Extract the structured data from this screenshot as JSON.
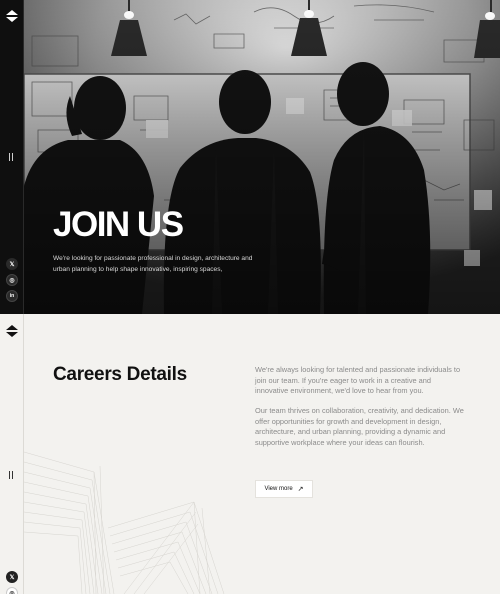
{
  "hero": {
    "title": "JOIN US",
    "description": "We're looking for passionate professional in design, architecture and urban planning to help shape innovative, inspiring spaces,"
  },
  "social": [
    {
      "icon": "x-icon",
      "glyph": "𝕏"
    },
    {
      "icon": "instagram-icon",
      "glyph": "◎"
    },
    {
      "icon": "linkedin-icon",
      "glyph": "in"
    }
  ],
  "careers": {
    "title": "Careers Details",
    "paragraph_1": "We're always looking for talented and passionate individuals to join our team. If you're eager to work in a creative and innovative environment, we'd love to hear from you.",
    "paragraph_2": "Our team thrives on collaboration, creativity, and dedication. We offer opportunities for growth and development in design, architecture, and urban planning, providing a dynamic and supportive workplace where your ideas can flourish.",
    "button_label": "View more",
    "button_icon": "↗"
  },
  "colors": {
    "hero_bg": "#1c1c1c",
    "page_bg": "#f3f2ef",
    "text_dark": "#111111",
    "text_muted": "#8b8b8b"
  }
}
